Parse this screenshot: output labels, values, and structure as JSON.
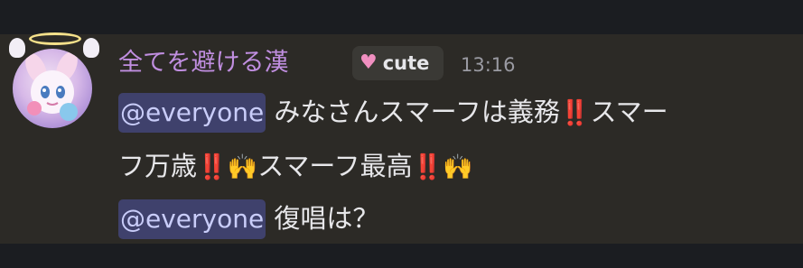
{
  "user": {
    "name": "全てを避ける漢",
    "tag_icon": "heart-icon",
    "tag_label": "cute",
    "timestamp": "13:16"
  },
  "message": {
    "line1": {
      "mention": "@everyone",
      "text_a": " みなさんスマーフは義務",
      "emoji_a": "‼️",
      "text_b": "スマー"
    },
    "line2": {
      "text_a": "フ万歳",
      "emoji_a": "‼️",
      "emoji_b": "🙌",
      "text_b": "スマーフ最高",
      "emoji_c": "‼️",
      "emoji_d": "🙌"
    },
    "line3": {
      "mention": "@everyone",
      "text_a": " 復唱は？"
    }
  },
  "colors": {
    "background": "#1b1d21",
    "message_background": "#2c2a26",
    "username": "#c08ee0",
    "mention_background": "#3f416c",
    "mention_text": "#c9cdf9",
    "timestamp": "#9a9aa2"
  }
}
